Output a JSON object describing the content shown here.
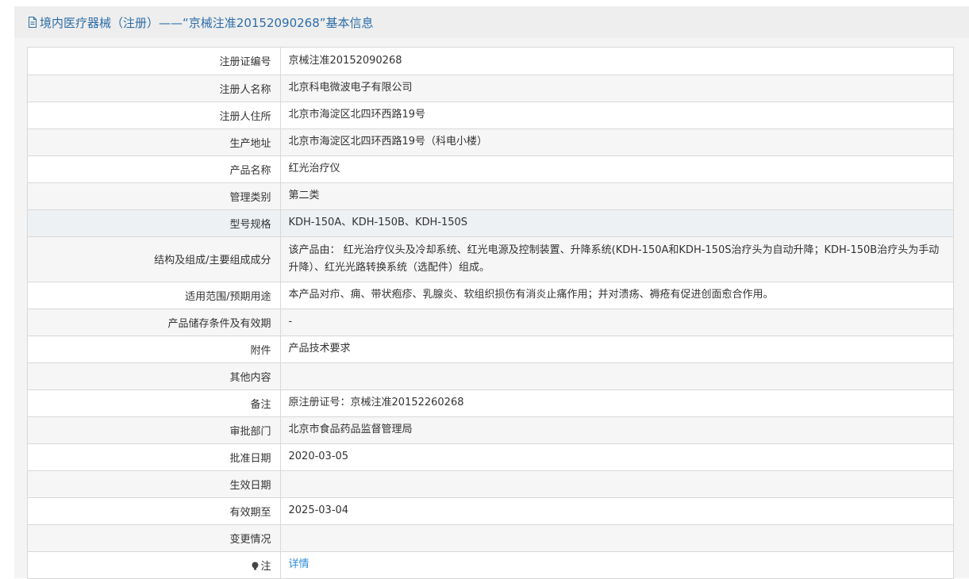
{
  "header": {
    "title": "境内医疗器械（注册）——“京械注准20152090268”基本信息"
  },
  "rows": [
    {
      "label": "注册证编号",
      "value": "京械注准20152090268"
    },
    {
      "label": "注册人名称",
      "value": "北京科电微波电子有限公司"
    },
    {
      "label": "注册人住所",
      "value": "北京市海淀区北四环西路19号"
    },
    {
      "label": "生产地址",
      "value": "北京市海淀区北四环西路19号（科电小楼）"
    },
    {
      "label": "产品名称",
      "value": "红光治疗仪"
    },
    {
      "label": "管理类别",
      "value": "第二类"
    },
    {
      "label": "型号规格",
      "value": "KDH-150A、KDH-150B、KDH-150S"
    },
    {
      "label": "结构及组成/主要组成成分",
      "value": "该产品由： 红光治疗仪头及冷却系统、红光电源及控制装置、升降系统(KDH-150A和KDH-150S治疗头为自动升降；KDH-150B治疗头为手动升降）、红光光路转换系统（选配件）组成。"
    },
    {
      "label": "适用范围/预期用途",
      "value": "本产品对疖、痈、带状疱疹、乳腺炎、软组织损伤有消炎止痛作用；并对溃疡、褥疮有促进创面愈合作用。"
    },
    {
      "label": "产品储存条件及有效期",
      "value": "-"
    },
    {
      "label": "附件",
      "value": "产品技术要求"
    },
    {
      "label": "其他内容",
      "value": ""
    },
    {
      "label": "备注",
      "value": "原注册证号：京械注准20152260268"
    },
    {
      "label": "审批部门",
      "value": "北京市食品药品监督管理局"
    },
    {
      "label": "批准日期",
      "value": "2020-03-05"
    },
    {
      "label": "生效日期",
      "value": ""
    },
    {
      "label": "有效期至",
      "value": "2025-03-04"
    },
    {
      "label": "变更情况",
      "value": ""
    },
    {
      "label": "注",
      "value": "详情"
    }
  ],
  "colors": {
    "accent": "#2d6ea8",
    "link": "#2d8cd6",
    "border": "#d8d8d8"
  },
  "icons": {
    "header": "document-icon",
    "note": "bulb-icon"
  }
}
